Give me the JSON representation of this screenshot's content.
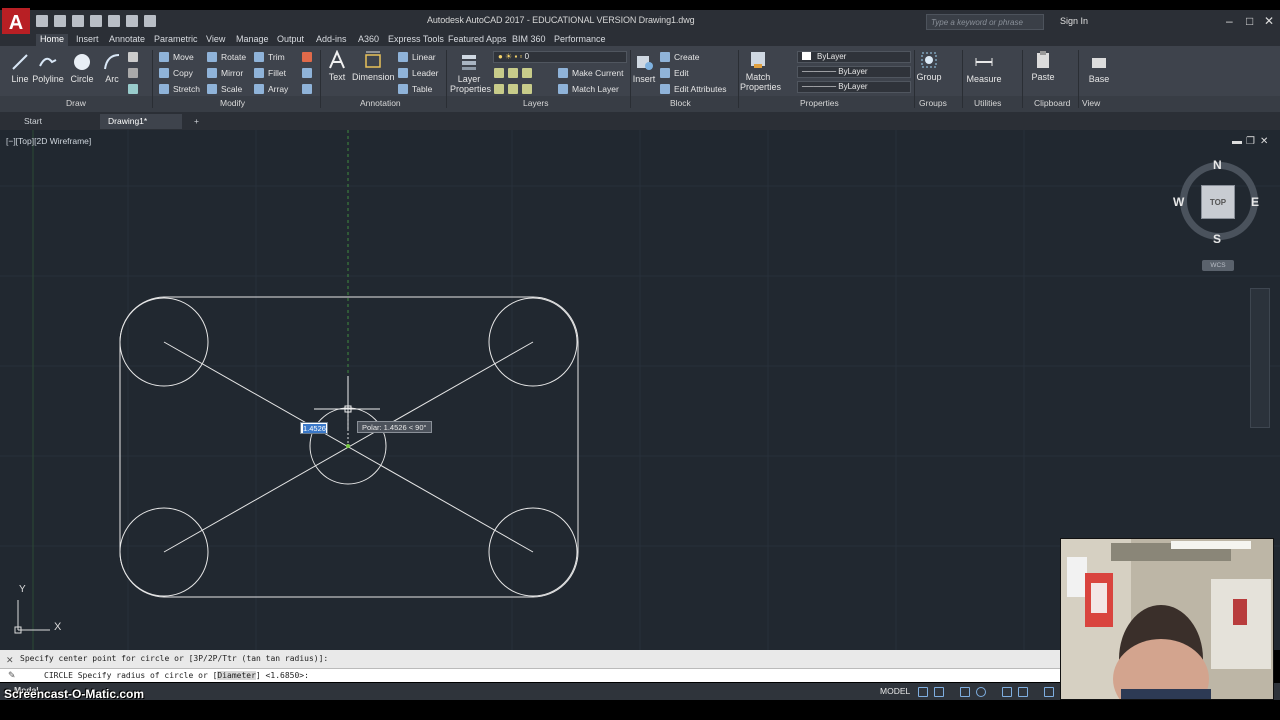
{
  "app": {
    "logo_letter": "A",
    "title": "Autodesk AutoCAD 2017 - EDUCATIONAL VERSION    Drawing1.dwg",
    "search_placeholder": "Type a keyword or phrase",
    "sign_in": "Sign In"
  },
  "ribbon_tabs": [
    "Home",
    "Insert",
    "Annotate",
    "Parametric",
    "View",
    "Manage",
    "Output",
    "Add-ins",
    "A360",
    "Express Tools",
    "Featured Apps",
    "BIM 360",
    "Performance"
  ],
  "draw": {
    "line": "Line",
    "polyline": "Polyline",
    "circle": "Circle",
    "arc": "Arc",
    "panel": "Draw"
  },
  "modify": {
    "move": "Move",
    "rotate": "Rotate",
    "trim": "Trim",
    "copy": "Copy",
    "mirror": "Mirror",
    "fillet": "Fillet",
    "stretch": "Stretch",
    "scale": "Scale",
    "array": "Array",
    "panel": "Modify"
  },
  "annotation": {
    "text": "Text",
    "dimension": "Dimension",
    "linear": "Linear",
    "leader": "Leader",
    "table": "Table",
    "panel": "Annotation"
  },
  "layers": {
    "layer_properties": "Layer Properties",
    "layer_value": "0",
    "make_current": "Make Current",
    "match_layer": "Match Layer",
    "panel": "Layers"
  },
  "block": {
    "insert": "Insert",
    "create": "Create",
    "edit": "Edit",
    "edit_attributes": "Edit Attributes",
    "panel": "Block"
  },
  "properties": {
    "match_properties": "Match Properties",
    "bylayer1": "ByLayer",
    "bylayer2": "ByLayer",
    "bylayer3": "ByLayer",
    "panel": "Properties"
  },
  "groups": {
    "group": "Group",
    "panel": "Groups"
  },
  "utilities": {
    "measure": "Measure",
    "panel": "Utilities"
  },
  "clipboard": {
    "paste": "Paste",
    "panel": "Clipboard"
  },
  "view": {
    "base": "Base",
    "panel": "View"
  },
  "doc_tabs": {
    "start": "Start",
    "drawing": "Drawing1*",
    "add": "+"
  },
  "viewport": {
    "label": "[−][Top][2D Wireframe]",
    "viewcube": {
      "n": "N",
      "s": "S",
      "e": "E",
      "w": "W",
      "top": "TOP",
      "wcs": "WCS"
    },
    "dynamic_input": "1.4526",
    "polar_tooltip": "Polar: 1.4526 < 90°",
    "ucs_y": "Y",
    "ucs_x": "X"
  },
  "command": {
    "history": "Specify center point for circle or [3P/2P/Ttr (tan tan radius)]:",
    "prompt_prefix": "CIRCLE Specify radius of circle or [",
    "prompt_keyword": "Diameter",
    "prompt_suffix": "] <1.6850>:"
  },
  "status": {
    "model_tab": "Model",
    "model_button": "MODEL"
  },
  "watermark": "Screencast-O-Matic.com",
  "colors": {
    "viewport_bg": "#212830",
    "ribbon_bg": "#3e434c",
    "accent": "#b81f24"
  }
}
